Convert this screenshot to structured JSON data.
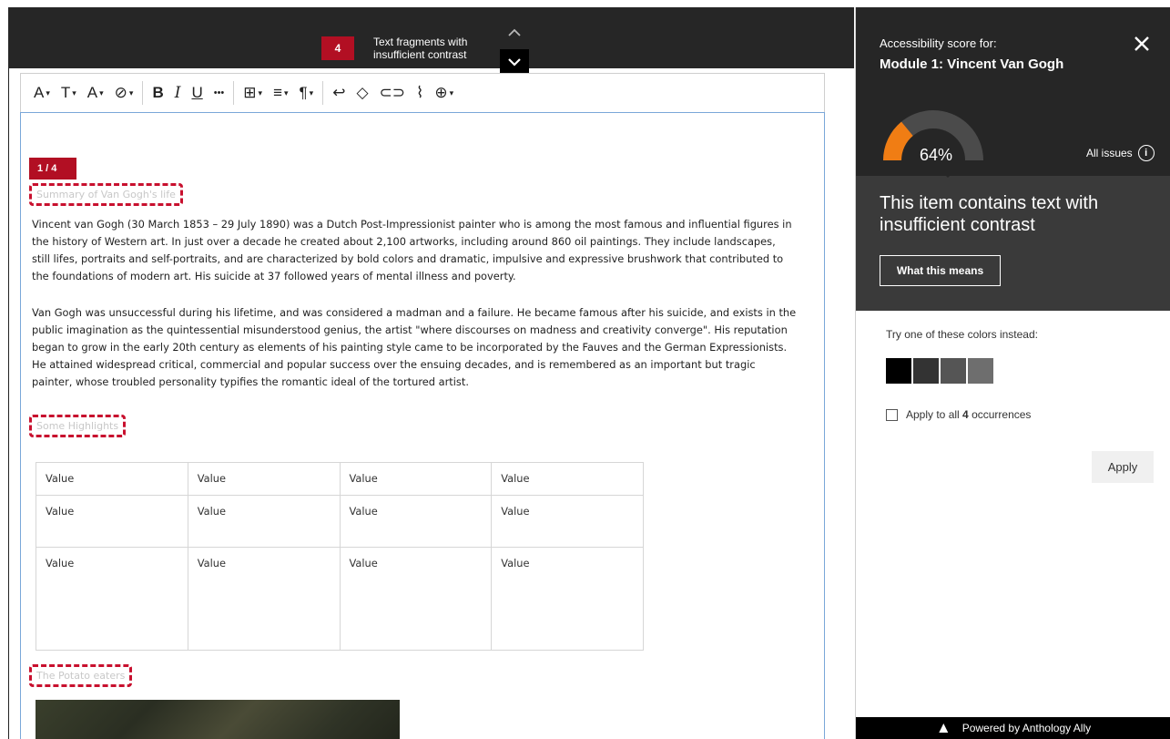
{
  "banner": {
    "issue_count": "4",
    "issue_label_line1": "Text fragments with",
    "issue_label_line2": "insufficient contrast",
    "nav_up_icon": "chevron-up-icon",
    "nav_down_icon": "chevron-down-icon"
  },
  "toolbar": {
    "items": [
      {
        "icon": "paragraph-style-icon",
        "glyph": "A",
        "caret": true
      },
      {
        "icon": "heading-icon",
        "glyph": "T",
        "caret": true
      },
      {
        "icon": "font-size-icon",
        "glyph": "A",
        "caret": true
      },
      {
        "icon": "text-color-icon",
        "glyph": "⊘",
        "caret": true
      },
      {
        "icon": "bold-icon",
        "glyph": "B"
      },
      {
        "icon": "italic-icon",
        "glyph": "I"
      },
      {
        "icon": "underline-icon",
        "glyph": "U"
      },
      {
        "icon": "more-icon",
        "glyph": "•••"
      },
      {
        "icon": "table-icon",
        "glyph": "⊞",
        "caret": true
      },
      {
        "icon": "align-icon",
        "glyph": "≡",
        "caret": true
      },
      {
        "icon": "paragraph-icon",
        "glyph": "¶",
        "caret": true
      },
      {
        "icon": "undo-icon",
        "glyph": "↩"
      },
      {
        "icon": "eraser-icon",
        "glyph": "◇"
      },
      {
        "icon": "link-icon",
        "glyph": "⊂⊃"
      },
      {
        "icon": "attachment-icon",
        "glyph": "⌇"
      },
      {
        "icon": "insert-icon",
        "glyph": "⊕",
        "caret": true
      }
    ]
  },
  "content": {
    "issue_position": "1 / 4",
    "heading1": "Summary of Van Gogh's life",
    "para1": "Vincent van Gogh (30 March 1853 – 29 July 1890) was a Dutch Post-Impressionist painter who is among the most famous and influential figures in the history of Western art. In just over a decade he created about 2,100 artworks, including around 860 oil paintings. They include landscapes, still lifes, portraits and self-portraits, and are characterized by bold colors and dramatic, impulsive and expressive brushwork that contributed to the foundations of modern art. His suicide at 37 followed years of mental illness and poverty.",
    "para2": "Van Gogh was unsuccessful during his lifetime, and was considered a madman and a failure. He became famous after his suicide, and exists in the public imagination as the quintessential misunderstood genius, the artist \"where discourses on madness and creativity converge\". His reputation began to grow in the early 20th century as elements of his painting style came to be incorporated by the Fauves and the German Expressionists. He attained widespread critical, commercial and popular success over the ensuing decades, and is remembered as an important but tragic painter, whose troubled personality typifies the romantic ideal of the tortured artist.",
    "heading2": "Some Highlights",
    "table": [
      [
        "Value",
        "Value",
        "Value",
        "Value"
      ],
      [
        "Value",
        "Value",
        "Value",
        "Value"
      ],
      [
        "Value",
        "Value",
        "Value",
        "Value"
      ]
    ],
    "heading3": "The Potato eaters"
  },
  "panel": {
    "score_for": "Accessibility score for:",
    "module_title": "Module 1: Vincent Van Gogh",
    "score": "64%",
    "score_fraction": 0.64,
    "all_issues": "All issues",
    "issue_text": "This item contains text with insufficient contrast",
    "what_means": "What this means",
    "try_label": "Try one of these colors instead:",
    "swatches": [
      "#000000",
      "#333333",
      "#555555",
      "#6e6e6e"
    ],
    "apply_all_prefix": "Apply to all ",
    "apply_all_count": "4",
    "apply_all_suffix": " occurrences",
    "apply": "Apply",
    "footer": "Powered by Anthology Ally",
    "colors": {
      "gauge_fill": "#f07d14",
      "gauge_track": "#4b4b4b",
      "issue_red": "#b20f23"
    }
  }
}
